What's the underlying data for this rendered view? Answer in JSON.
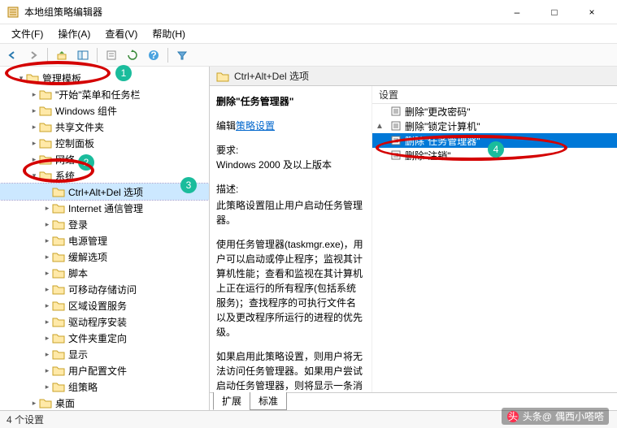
{
  "window": {
    "title": "本地组策略编辑器",
    "min": "–",
    "max": "□",
    "close": "×"
  },
  "menu": {
    "file": "文件(F)",
    "action": "操作(A)",
    "view": "查看(V)",
    "help": "帮助(H)"
  },
  "tree": {
    "root": "管理模板",
    "items": [
      "\"开始\"菜单和任务栏",
      "Windows 组件",
      "共享文件夹",
      "控制面板",
      "网络"
    ],
    "system": "系统",
    "system_children_pre": [],
    "selected": "Ctrl+Alt+Del 选项",
    "system_children_post": [
      "Internet 通信管理",
      "登录",
      "电源管理",
      "缓解选项",
      "脚本",
      "可移动存储访问",
      "区域设置服务",
      "驱动程序安装",
      "文件夹重定向",
      "显示",
      "用户配置文件",
      "组策略"
    ],
    "after_system": [
      "桌面"
    ]
  },
  "content": {
    "header": "Ctrl+Alt+Del 选项",
    "desc_title": "删除\"任务管理器\"",
    "edit_link_prefix": "编辑",
    "edit_link": "策略设置",
    "req_label": "要求:",
    "req_value": "Windows 2000 及以上版本",
    "desc_label": "描述:",
    "desc_p1": "此策略设置阻止用户启动任务管理器。",
    "desc_p2": "使用任务管理器(taskmgr.exe)，用户可以启动或停止程序；监视其计算机性能；查看和监视在其计算机上正在运行的所有程序(包括系统服务)；查找程序的可执行文件名以及更改程序所运行的进程的优先级。",
    "desc_p3": "如果启用此策略设置，则用户将无法访问任务管理器。如果用户尝试启动任务管理器，则将显示一条消息…"
  },
  "list": {
    "col_header": "设置",
    "rows": [
      "删除\"更改密码\"",
      "删除\"锁定计算机\"",
      "删除\"任务管理器\"",
      "删除\"注销\""
    ],
    "selected_index": 2
  },
  "tabs": {
    "extended": "扩展",
    "standard": "标准"
  },
  "status": "4 个设置",
  "annotations": {
    "badge1": "1",
    "badge2": "2",
    "badge3": "3",
    "badge4": "4"
  },
  "watermark": {
    "prefix": "头条@",
    "name": "偶西小嗒嗒"
  }
}
